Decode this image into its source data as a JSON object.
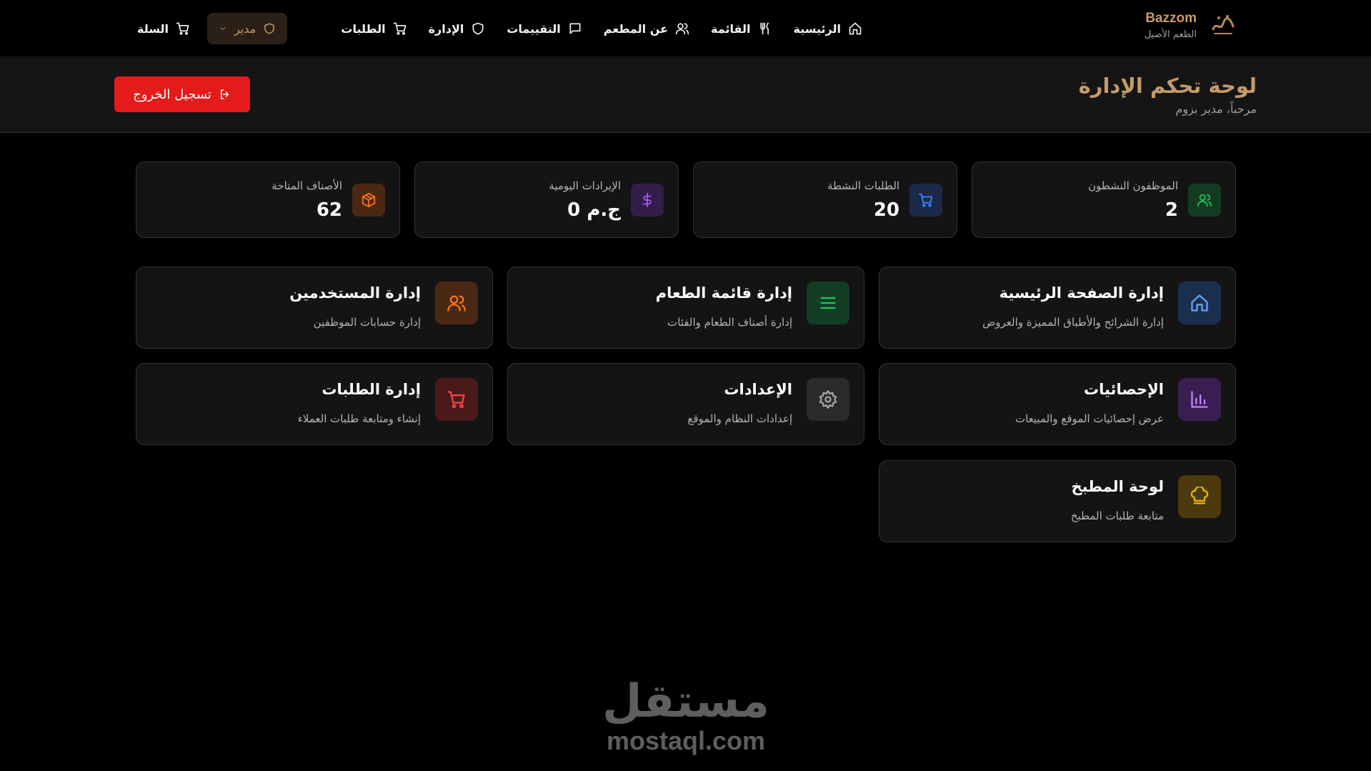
{
  "brand": {
    "name": "Bazzom",
    "subtitle": "الطعم الأصيل"
  },
  "nav": {
    "items": [
      {
        "label": "الرئيسية",
        "icon": "home-icon"
      },
      {
        "label": "القائمة",
        "icon": "utensils-icon"
      },
      {
        "label": "عن المطعم",
        "icon": "users-icon"
      },
      {
        "label": "التقييمات",
        "icon": "message-icon"
      },
      {
        "label": "الإدارة",
        "icon": "shield-icon"
      },
      {
        "label": "الطلبات",
        "icon": "cart-icon"
      }
    ],
    "role_label": "مدير",
    "cart_label": "السلة"
  },
  "header": {
    "title": "لوحة تحكم الإدارة",
    "welcome": "مرحباً، مدير بزوم",
    "logout_label": "تسجيل الخروج"
  },
  "stats": [
    {
      "label": "الموظفون النشطون",
      "value": "2",
      "icon": "users-icon",
      "color": "#22c55e"
    },
    {
      "label": "الطلبات النشطة",
      "value": "20",
      "icon": "cart-icon",
      "color": "#3b82f6"
    },
    {
      "label": "الإيرادات اليومية",
      "value": "0 ج.م",
      "icon": "dollar-icon",
      "color": "#a855f7"
    },
    {
      "label": "الأصناف المتاحة",
      "value": "62",
      "icon": "package-icon",
      "color": "#f97316"
    }
  ],
  "cards": [
    {
      "title": "إدارة الصفحة الرئيسية",
      "desc": "إدارة الشرائح والأطباق المميزة والعروض",
      "icon": "home-icon",
      "color": "#60a5fa"
    },
    {
      "title": "إدارة قائمة الطعام",
      "desc": "إدارة أصناف الطعام والفئات",
      "icon": "menu-list-icon",
      "color": "#22c55e"
    },
    {
      "title": "إدارة المستخدمين",
      "desc": "إدارة حسابات الموظفين",
      "icon": "users-icon",
      "color": "#f97316"
    },
    {
      "title": "الإحصائيات",
      "desc": "عرض إحصائيات الموقع والمبيعات",
      "icon": "bar-chart-icon",
      "color": "#c084fc"
    },
    {
      "title": "الإعدادات",
      "desc": "إعدادات النظام والموقع",
      "icon": "gear-icon",
      "color": "#a3a3a3"
    },
    {
      "title": "إدارة الطلبات",
      "desc": "إنشاء ومتابعة طلبات العملاء",
      "icon": "cart-icon",
      "color": "#ef4444"
    },
    {
      "title": "لوحة المطبخ",
      "desc": "متابعة طلبات المطبخ",
      "icon": "chef-hat-icon",
      "color": "#eab308"
    }
  ],
  "watermark": {
    "arabic": "مستقل",
    "latin": "mostaql.com"
  }
}
